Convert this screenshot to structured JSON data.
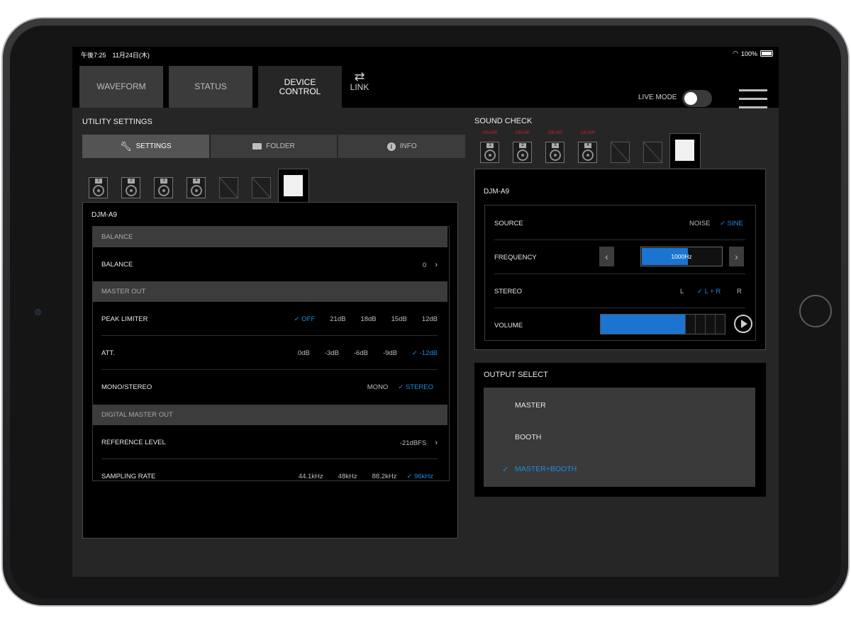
{
  "status_bar": {
    "time": "午後7:25　11月24日(木)",
    "battery": "100%"
  },
  "tabs": [
    {
      "label": "WAVEFORM"
    },
    {
      "label": "STATUS"
    },
    {
      "label": "DEVICE CONTROL"
    }
  ],
  "link": {
    "label": "LINK"
  },
  "live_mode": {
    "label": "LIVE MODE",
    "on": false
  },
  "utility": {
    "title": "UTILITY SETTINGS",
    "segments": {
      "settings": "SETTINGS",
      "folder": "FOLDER",
      "info": "INFO"
    },
    "decks": [
      "1",
      "2",
      "3",
      "4"
    ],
    "device_name": "DJM-A9",
    "sections": {
      "balance": "BALANCE",
      "master_out": "MASTER OUT",
      "digital_master_out": "DIGITAL MASTER OUT"
    },
    "rows": {
      "balance": {
        "label": "BALANCE",
        "value": "0"
      },
      "peak_limiter": {
        "label": "PEAK LIMITER",
        "options": [
          "OFF",
          "21dB",
          "18dB",
          "15dB",
          "12dB"
        ],
        "selected": "OFF"
      },
      "att": {
        "label": "ATT.",
        "options": [
          "0dB",
          "-3dB",
          "-6dB",
          "-9dB",
          "-12dB"
        ],
        "selected": "-12dB"
      },
      "mono_stereo": {
        "label": "MONO/STEREO",
        "options": [
          "MONO",
          "STEREO"
        ],
        "selected": "STEREO"
      },
      "reference_level": {
        "label": "REFERENCE LEVEL",
        "value": "-21dBFS"
      },
      "sampling_rate": {
        "label": "SAMPLING RATE",
        "options": [
          "44.1kHz",
          "48kHz",
          "88.2kHz",
          "96kHz"
        ],
        "selected": "96kHz"
      }
    }
  },
  "sound_check": {
    "title": "SOUND CHECK",
    "on_air": "ON AIR",
    "decks": [
      "1",
      "2",
      "3",
      "4"
    ],
    "device_name": "DJM-A9",
    "source": {
      "label": "SOURCE",
      "options": [
        "NOISE",
        "SINE"
      ],
      "selected": "SINE"
    },
    "frequency": {
      "label": "FREQUENCY",
      "value": "1000Hz",
      "fill_fraction": 0.58
    },
    "stereo": {
      "label": "STEREO",
      "options": [
        "L",
        "L + R",
        "R"
      ],
      "selected": "L + R"
    },
    "volume": {
      "label": "VOLUME",
      "level_fraction": 0.68
    }
  },
  "output_select": {
    "title": "OUTPUT SELECT",
    "options": [
      "MASTER",
      "BOOTH",
      "MASTER+BOOTH"
    ],
    "selected": "MASTER+BOOTH"
  },
  "colors": {
    "accent": "#1b8de0",
    "on_air": "#d32020",
    "background": "#262626"
  }
}
